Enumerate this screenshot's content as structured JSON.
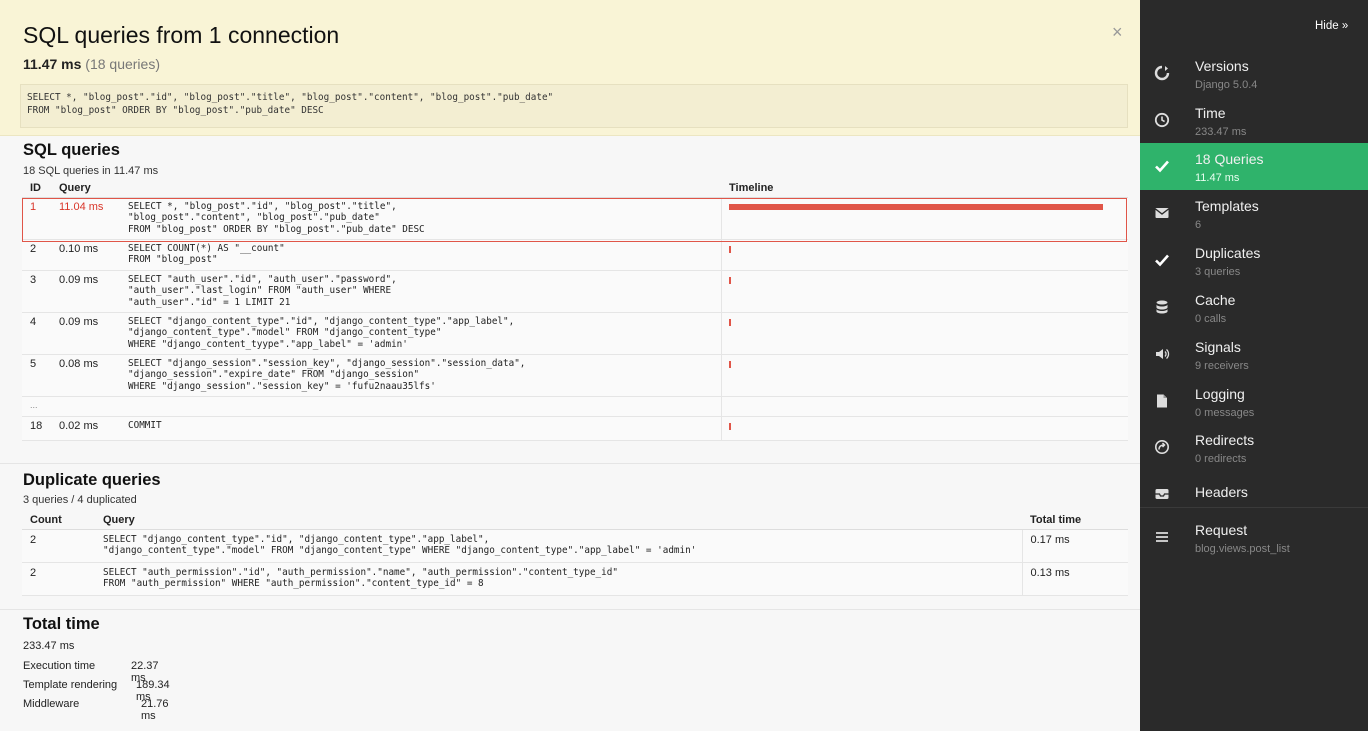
{
  "summary": {
    "title": "SQL queries from 1 connection",
    "time": "11.47 ms",
    "count": "(18 queries)",
    "sql": "SELECT *, \"blog_post\".\"id\", \"blog_post\".\"title\", \"blog_post\".\"content\", \"blog_post\".\"pub_date\"\nFROM \"blog_post\" ORDER BY \"blog_post\".\"pub_date\" DESC",
    "close": "×"
  },
  "sql_section": {
    "title": "SQL queries",
    "subtitle": "18 SQL queries in 11.47 ms",
    "headers": {
      "id": "ID",
      "query": "Query",
      "timeline": "Timeline"
    },
    "rows": [
      {
        "id": "1",
        "time": "11.04 ms",
        "sql": "SELECT *, \"blog_post\".\"id\", \"blog_post\".\"title\",\n\"blog_post\".\"content\", \"blog_post\".\"pub_date\"\nFROM \"blog_post\" ORDER BY \"blog_post\".\"pub_date\" DESC",
        "timeline_fraction": 0.96
      },
      {
        "id": "2",
        "time": "0.10 ms",
        "sql": "SELECT COUNT(*) AS \"__count\"\nFROM \"blog_post\"",
        "timeline_fraction": 0.009
      },
      {
        "id": "3",
        "time": "0.09 ms",
        "sql": "SELECT \"auth_user\".\"id\", \"auth_user\".\"password\",\n\"auth_user\".\"last_login\" FROM \"auth_user\" WHERE\n\"auth_user\".\"id\" = 1 LIMIT 21",
        "timeline_fraction": 0.008
      },
      {
        "id": "4",
        "time": "0.09 ms",
        "sql": "SELECT \"django_content_type\".\"id\", \"django_content_type\".\"app_label\",\n\"django_content_type\".\"model\" FROM \"django_content_type\"\nWHERE \"django_content_tyype\".\"app_label\" = 'admin'",
        "timeline_fraction": 0.008
      },
      {
        "id": "5",
        "time": "0.08 ms",
        "sql": "SELECT \"django_session\".\"session_key\", \"django_session\".\"session_data\",\n\"django_session\".\"expire_date\" FROM \"django_session\"\nWHERE \"django_session\".\"session_key\" = 'fufu2naau35lfs'",
        "timeline_fraction": 0.007
      },
      {
        "id": "...",
        "time": "",
        "sql": "",
        "timeline_fraction": null
      },
      {
        "id": "18",
        "time": "0.02 ms",
        "sql": "COMMIT",
        "timeline_fraction": 0.002
      }
    ]
  },
  "dup_section": {
    "title": "Duplicate queries",
    "subtitle": "3 queries / 4 duplicated",
    "headers": {
      "count": "Count",
      "query": "Query",
      "total": "Total time"
    },
    "rows": [
      {
        "count": "2",
        "sql": "SELECT \"django_content_type\".\"id\", \"django_content_type\".\"app_label\",\n\"django_content_type\".\"model\" FROM \"django_content_type\" WHERE \"django_content_type\".\"app_label\" = 'admin'",
        "total": "0.17 ms"
      },
      {
        "count": "2",
        "sql": "SELECT \"auth_permission\".\"id\", \"auth_permission\".\"name\", \"auth_permission\".\"content_type_id\"\nFROM \"auth_permission\" WHERE \"auth_permission\".\"content_type_id\" = 8",
        "total": "0.13 ms"
      }
    ]
  },
  "totals": {
    "title": "Total time",
    "total": "233.47 ms",
    "rows": [
      {
        "label": "Execution time",
        "value": "22.37 ms"
      },
      {
        "label": "Template rendering",
        "value": "189.34 ms"
      },
      {
        "label": "Middleware",
        "value": "21.76 ms"
      }
    ]
  },
  "sidebar": {
    "hide": "Hide »",
    "panels": [
      {
        "name": "Versions",
        "sub": "Django 5.0.4",
        "icon": "versions-icon",
        "active": false
      },
      {
        "name": "Time",
        "sub": "233.47 ms",
        "icon": "clock-icon",
        "active": false
      },
      {
        "name": "18 Queries",
        "sub": "11.47 ms",
        "icon": "check-icon",
        "active": true
      },
      {
        "name": "Templates",
        "sub": "6",
        "icon": "envelope-icon",
        "active": false
      },
      {
        "name": "Duplicates",
        "sub": "3 queries",
        "icon": "check-icon",
        "active": false
      },
      {
        "name": "Cache",
        "sub": "0 calls",
        "icon": "database-icon",
        "active": false
      },
      {
        "name": "Signals",
        "sub": "9 receivers",
        "icon": "speaker-icon",
        "active": false
      },
      {
        "name": "Logging",
        "sub": "0 messages",
        "icon": "file-icon",
        "active": false
      },
      {
        "name": "Redirects",
        "sub": "0 redirects",
        "icon": "redirect-icon",
        "active": false
      },
      {
        "name": "Headers",
        "sub": "",
        "icon": "inbox-icon",
        "active": false
      },
      {
        "name": "Request",
        "sub": "blog.views.post_list",
        "icon": "list-icon",
        "active": false
      }
    ]
  }
}
